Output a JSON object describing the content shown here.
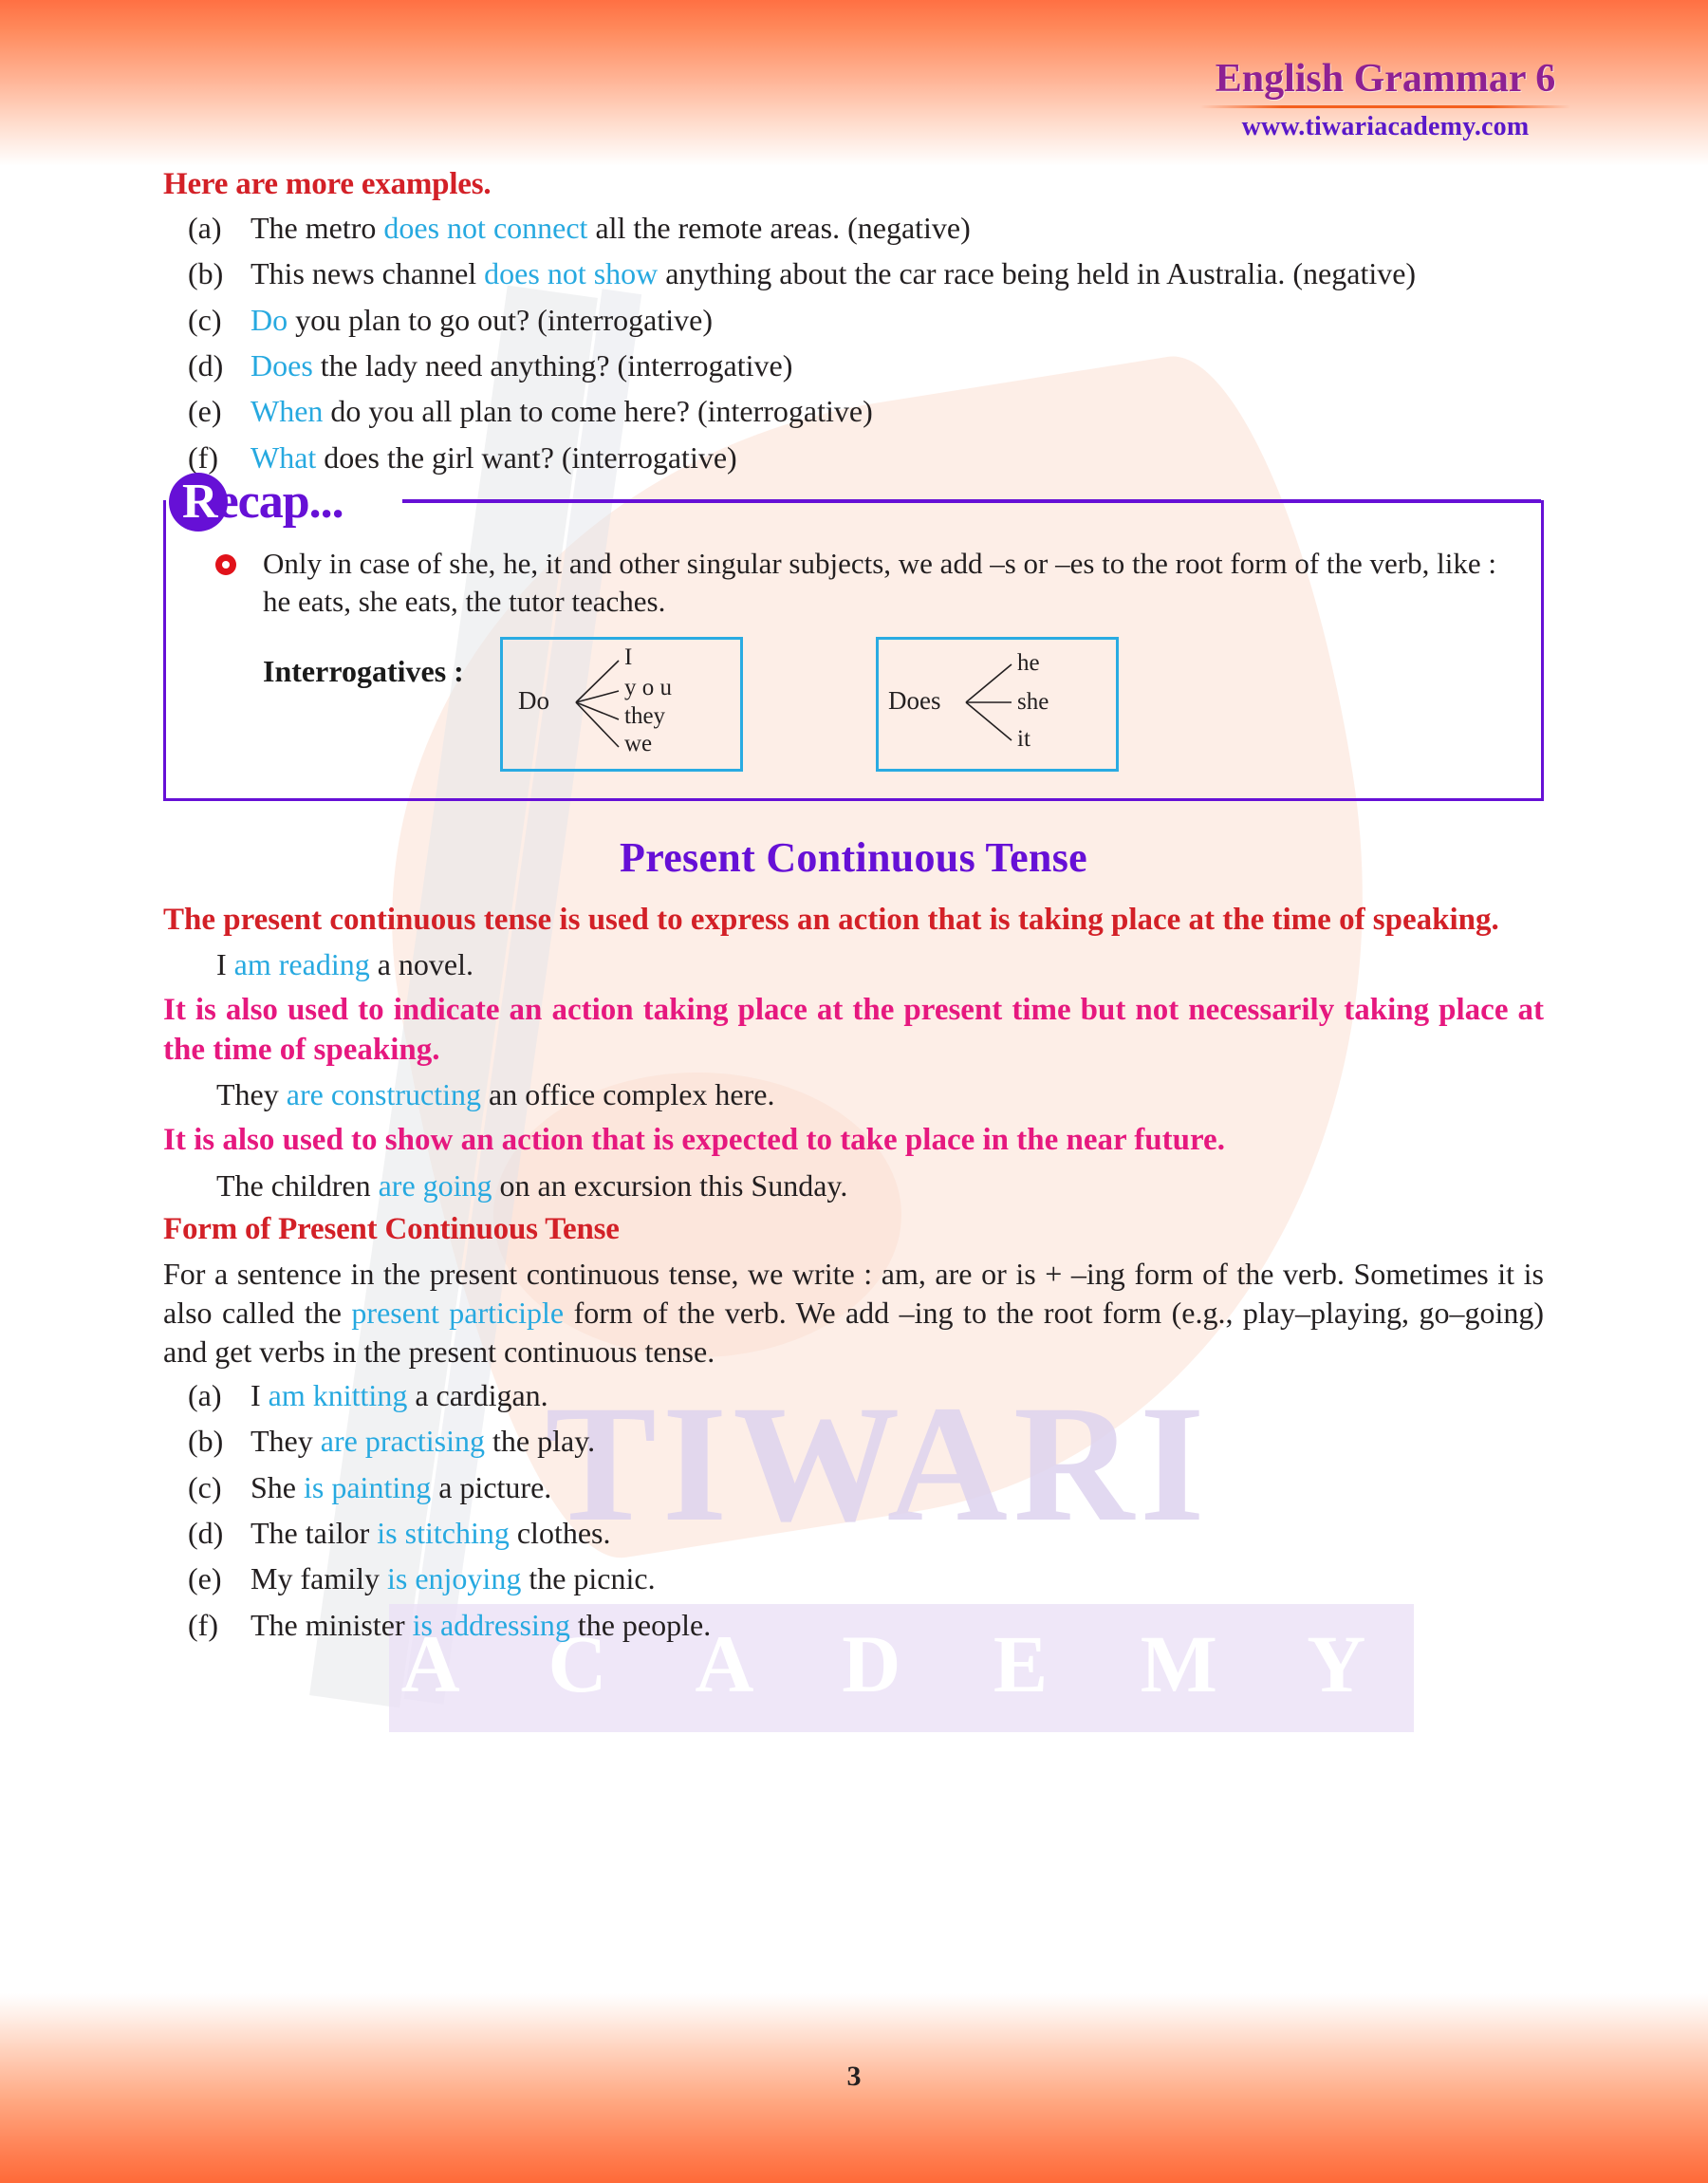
{
  "header": {
    "title": "English Grammar 6",
    "url": "www.tiwariacademy.com"
  },
  "watermark": {
    "word": "TIWARI",
    "academy": "A C A D E M Y"
  },
  "examples_heading": "Here are more examples.",
  "examples": [
    {
      "marker": "(a)",
      "pre": "The metro ",
      "hl": "does not connect",
      "post": " all the remote areas. (negative)"
    },
    {
      "marker": "(b)",
      "pre": "This news channel ",
      "hl": "does not show",
      "post": " anything about the car race being held in Australia. (negative)"
    },
    {
      "marker": "(c)",
      "pre": "",
      "hl": "Do",
      "post": " you plan to go out? (interrogative)"
    },
    {
      "marker": "(d)",
      "pre": "",
      "hl": "Does",
      "post": " the lady need anything? (interrogative)"
    },
    {
      "marker": "(e)",
      "pre": "",
      "hl": "When",
      "post": " do you all plan to come here? (interrogative)"
    },
    {
      "marker": "(f)",
      "pre": "",
      "hl": "What",
      "post": " does the girl want? (interrogative)"
    }
  ],
  "recap": {
    "label": "Recap...",
    "label_first": "R",
    "label_rest": "ecap...",
    "note": "Only in case of she, he, it and other singular subjects, we add –s or –es to the root form of the verb, like : he eats, she eats, the tutor teaches.",
    "interrogatives_label": "Interrogatives :",
    "tree_do": {
      "root": "Do",
      "branches": [
        "I",
        "y o u",
        "they",
        "we"
      ]
    },
    "tree_does": {
      "root": "Does",
      "branches": [
        "he",
        "she",
        "it"
      ]
    }
  },
  "section": {
    "title": "Present Continuous Tense",
    "rule1": "The present continuous tense is used to express an action that is taking place at the time of speaking.",
    "example1": {
      "pre": "I ",
      "hl": "am reading",
      "post": " a novel."
    },
    "rule2": "It is also used to indicate an action taking place at the present time but not necessarily taking place at the time of speaking.",
    "example2": {
      "pre": "They ",
      "hl": "are constructing",
      "post": " an office complex here."
    },
    "rule3": "It is also used to show an action that is expected to take place in the near future.",
    "example3": {
      "pre": "The children ",
      "hl": "are going",
      "post": " on an excursion this Sunday."
    },
    "form_heading": "Form of Present Continuous Tense",
    "form_body_1": "For a sentence in the present continuous tense, we write : am, are or is + –ing form of the verb. Sometimes it is also called the ",
    "form_body_hl": "present participle",
    "form_body_2": " form of the verb. We add –ing to the root form (e.g., play–playing, go–going) and get verbs in the present continuous tense."
  },
  "form_examples": [
    {
      "marker": "(a)",
      "pre": "I ",
      "hl": "am knitting",
      "post": " a cardigan."
    },
    {
      "marker": "(b)",
      "pre": "They ",
      "hl": "are practising",
      "post": " the play."
    },
    {
      "marker": "(c)",
      "pre": "She ",
      "hl": "is painting",
      "post": " a picture."
    },
    {
      "marker": "(d)",
      "pre": "The tailor ",
      "hl": "is stitching",
      "post": " clothes."
    },
    {
      "marker": "(e)",
      "pre": "My family ",
      "hl": "is enjoying",
      "post": " the picnic."
    },
    {
      "marker": "(f)",
      "pre": "The minister ",
      "hl": "is addressing",
      "post": " the people."
    }
  ],
  "page_number": "3",
  "colors": {
    "accent_red": "#d32027",
    "accent_magenta": "#e6187f",
    "accent_purple": "#6610d6",
    "highlight_blue": "#27a9e0",
    "header_purple": "#8e2193",
    "url_purple": "#5918c9",
    "box_blue": "#29abe2"
  }
}
